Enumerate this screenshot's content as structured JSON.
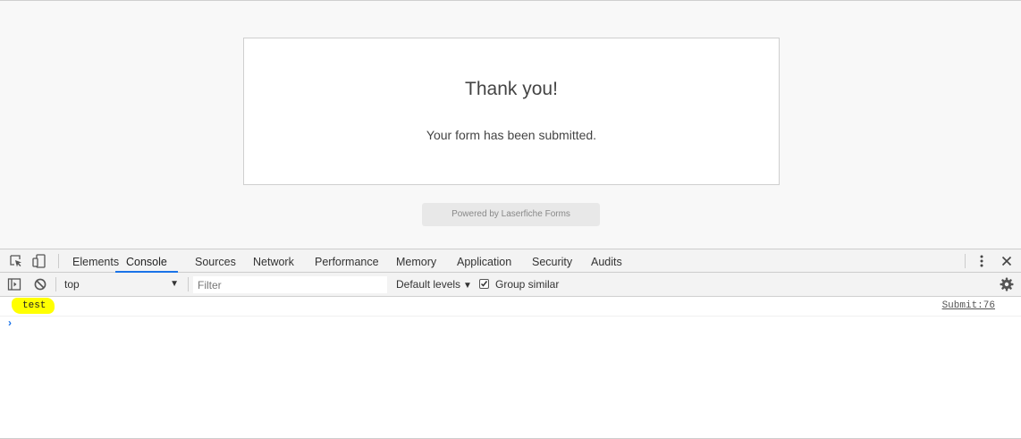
{
  "page": {
    "thanks_title": "Thank you!",
    "thanks_message": "Your form has been submitted.",
    "powered_by": "Powered by Laserfiche Forms"
  },
  "devtools": {
    "tabs": [
      {
        "label": "Elements",
        "active": false
      },
      {
        "label": "Console",
        "active": true
      },
      {
        "label": "Sources",
        "active": false
      },
      {
        "label": "Network",
        "active": false
      },
      {
        "label": "Performance",
        "active": false
      },
      {
        "label": "Memory",
        "active": false
      },
      {
        "label": "Application",
        "active": false
      },
      {
        "label": "Security",
        "active": false
      },
      {
        "label": "Audits",
        "active": false
      }
    ],
    "icons": [
      "inspect-element-icon",
      "device-toolbar-icon",
      "more-options-icon",
      "close-icon"
    ],
    "accent_color": "#1a73e8"
  },
  "console": {
    "context": "top",
    "filter_placeholder": "Filter",
    "filter_value": "",
    "levels_label": "Default levels",
    "group_similar_label": "Group similar",
    "group_similar_checked": true,
    "toolbar_icons": [
      "show-sidebar-icon",
      "clear-console-icon",
      "settings-gear-icon"
    ],
    "log": {
      "message": "test",
      "source": "Submit:76",
      "highlight_color": "#ffff00"
    },
    "prompt_glyph": "›"
  }
}
